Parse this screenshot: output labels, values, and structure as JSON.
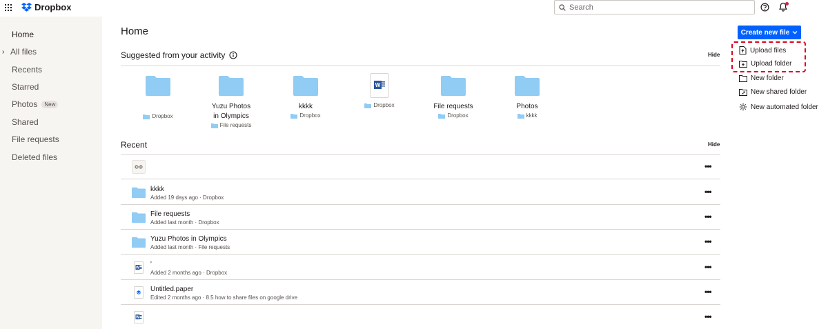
{
  "header": {
    "logo_text": "Dropbox",
    "search_placeholder": "Search"
  },
  "sidebar": {
    "items": [
      {
        "label": "Home"
      },
      {
        "label": "All files"
      },
      {
        "label": "Recents"
      },
      {
        "label": "Starred"
      },
      {
        "label": "Photos",
        "badge": "New"
      },
      {
        "label": "Shared"
      },
      {
        "label": "File requests"
      },
      {
        "label": "Deleted files"
      }
    ]
  },
  "main": {
    "title": "Home",
    "suggested": {
      "title": "Suggested from your activity",
      "hide_label": "Hide",
      "items": [
        {
          "name": "",
          "location": "Dropbox",
          "icon": "folder-icon"
        },
        {
          "name": "Yuzu Photos in Olympics",
          "location": "File requests",
          "icon": "folder-icon"
        },
        {
          "name": "kkkk",
          "location": "Dropbox",
          "icon": "folder-icon"
        },
        {
          "name": "",
          "location": "Dropbox",
          "icon": "word-doc-icon"
        },
        {
          "name": "File requests",
          "location": "Dropbox",
          "icon": "folder-icon"
        },
        {
          "name": "Photos",
          "location": "kkkk",
          "icon": "folder-icon"
        }
      ]
    },
    "recent": {
      "title": "Recent",
      "hide_label": "Hide",
      "more_label": "•••",
      "rows": [
        {
          "name": "",
          "meta": "",
          "icon": "link-icon"
        },
        {
          "name": "kkkk",
          "meta": "Added 19 days ago · Dropbox",
          "icon": "folder-icon"
        },
        {
          "name": "File requests",
          "meta": "Added last month · Dropbox",
          "icon": "folder-icon"
        },
        {
          "name": "Yuzu Photos in Olympics",
          "meta": "Added last month · File requests",
          "icon": "folder-icon"
        },
        {
          "name": "'",
          "meta": "Added 2 months ago · Dropbox",
          "icon": "word-doc-icon"
        },
        {
          "name": "Untitled.paper",
          "meta": "Edited 2 months ago · 8.5 how to share files on google drive",
          "icon": "paper-doc-icon"
        },
        {
          "name": "",
          "meta": "",
          "icon": "word-doc-icon"
        }
      ]
    }
  },
  "actions": {
    "create_label": "Create new file",
    "items": [
      {
        "label": "Upload files",
        "icon": "upload-file-icon"
      },
      {
        "label": "Upload folder",
        "icon": "upload-folder-icon"
      },
      {
        "label": "New folder",
        "icon": "new-folder-icon"
      },
      {
        "label": "New shared folder",
        "icon": "shared-folder-icon"
      },
      {
        "label": "New automated folder",
        "icon": "automated-folder-icon"
      }
    ]
  },
  "colors": {
    "primary": "#0061fe",
    "folder": "#90ccf4",
    "highlight": "#e0001b",
    "sidebar_bg": "#f7f5f2"
  }
}
